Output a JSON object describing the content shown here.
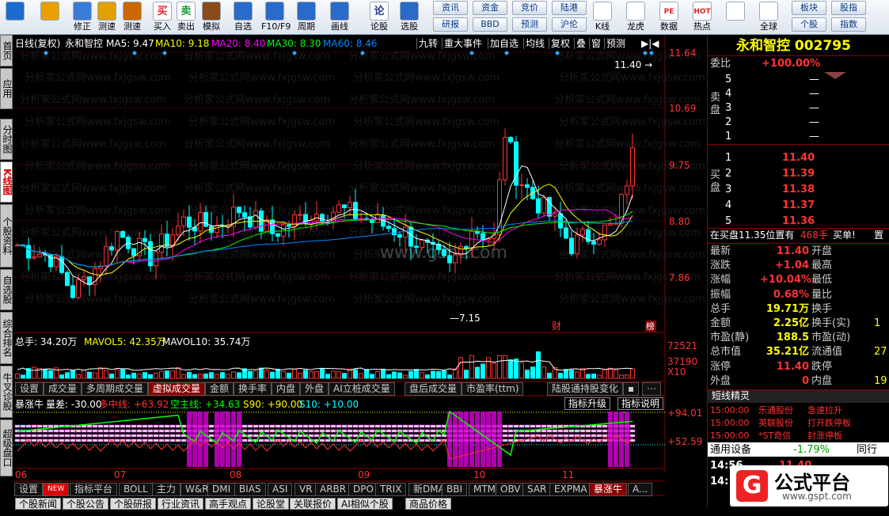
{
  "toolbar": {
    "buttons": [
      {
        "label": "",
        "icon": "home-icon"
      },
      {
        "label": "",
        "icon": "back-arrow-icon"
      },
      {
        "label": "修正",
        "icon": "arrow-up-down-icon"
      },
      {
        "label": "测速",
        "icon": "speed-icon"
      },
      {
        "label": "测速",
        "icon": "clock-icon"
      },
      {
        "label": "买入",
        "icon": "buy-icon",
        "glyph": "买"
      },
      {
        "label": "卖出",
        "icon": "sell-icon",
        "glyph": "卖"
      },
      {
        "label": "模拟",
        "icon": "hammer-icon"
      },
      {
        "label": "自选",
        "icon": "portfolio-icon"
      },
      {
        "label": "F10/F9",
        "icon": "f10-icon"
      },
      {
        "label": "周期",
        "icon": "period-icon"
      },
      {
        "label": "画线",
        "icon": "draw-line-icon"
      },
      {
        "label": "论股",
        "icon": "discuss-icon",
        "glyph": "论"
      },
      {
        "label": "选股",
        "icon": "select-stock-icon"
      }
    ],
    "small_buttons": [
      "资讯",
      "资金",
      "竞价",
      "陆港",
      "研报",
      "BBD",
      "预测",
      "沪伦"
    ],
    "right_buttons": [
      {
        "label": "K线",
        "icon": "kline-chart-icon"
      },
      {
        "label": "龙虎",
        "icon": "dragon-tiger-icon"
      },
      {
        "label": "数据",
        "icon": "pe-data-icon",
        "glyph": "PE"
      },
      {
        "label": "热点",
        "icon": "hot-icon",
        "glyph": "HOT"
      },
      {
        "label": "",
        "icon": "phone-icon"
      },
      {
        "label": "全球",
        "icon": "globe-icon"
      }
    ],
    "right_small": [
      "板块",
      "股指",
      "个股",
      "指数"
    ]
  },
  "left_tabs": [
    "首页",
    "应用",
    "分时图",
    "K线图",
    "个股资料",
    "自选股",
    "综合排名",
    "牛叉诊股",
    "超级盘口"
  ],
  "chart_header": {
    "mode": "日线(复权)",
    "stock": "永和智控",
    "ma5": "MA5: 9.47",
    "ma10": "MA10: 9.18",
    "ma20": "MA20: 8.40",
    "ma30": "MA30: 8.30",
    "ma60": "MA60: 8.46",
    "tabs": [
      "九转",
      "重大事件",
      "加自选",
      "均线",
      "复权",
      "叠",
      "窗",
      "预测"
    ]
  },
  "watermark_text": "分析家公式网www.fxjgsw.com",
  "watermark_center": "www.gspt.com",
  "price_axis": [
    "11.64",
    "10.69",
    "9.75",
    "8.80",
    "7.86"
  ],
  "high_label": "11.40",
  "low_label": "7.15",
  "marker_cai": "财",
  "marker_bang": "榜",
  "volume_header": {
    "total": "总手: 34.20万",
    "mavol5": "MAVOL5: 42.35万",
    "mavol10": "MAVOL10: 35.74万"
  },
  "volume_axis": [
    "72521",
    "37190",
    "X10"
  ],
  "panel_tabs": [
    "设置",
    "成交量",
    "多周期成交量",
    "虚拟成交量",
    "金额",
    "换手率",
    "内盘",
    "外盘",
    "AI立桩成交量",
    "盘后成交量",
    "市盈率(ttm)",
    "陆股通持股变化",
    "▪",
    "⋯"
  ],
  "indicator_header": {
    "name": "暴涨牛",
    "spread": "量差: -30.00",
    "long": "多中线: +63.92",
    "short": "空主线: +34.63",
    "s90": "S90: +90.00",
    "s10": "S10: +10.00",
    "btn1": "指标升级",
    "btn2": "指标说明"
  },
  "indicator_axis": [
    "+94.01",
    "+52.59"
  ],
  "date_axis": [
    "06",
    "07",
    "08",
    "09",
    "10",
    "11"
  ],
  "bottom_tabs": [
    "设置",
    "NEW",
    "指标平台",
    "BOLL",
    "主力",
    "W&R",
    "DMI",
    "BIAS",
    "ASI",
    "VR",
    "ARBR",
    "DPO",
    "TRIX",
    "新DMA",
    "BBI",
    "MTM",
    "OBV",
    "SAR",
    "EXPMA",
    "暴涨牛",
    "A..."
  ],
  "news_tabs": [
    "个股新闻",
    "个股公告",
    "个股研报",
    "行业资讯",
    "高手观点",
    "论股堂",
    "关联报价",
    "AI相似个股",
    "商品价格"
  ],
  "quote": {
    "title": "永和智控 002795",
    "webi_label": "委比",
    "webi": "+100.00%",
    "sell_label": "卖盘",
    "sells": [
      {
        "lvl": "5",
        "p": "",
        "v": "—"
      },
      {
        "lvl": "4",
        "p": "",
        "v": "—"
      },
      {
        "lvl": "3",
        "p": "",
        "v": "—"
      },
      {
        "lvl": "2",
        "p": "",
        "v": "—"
      },
      {
        "lvl": "1",
        "p": "",
        "v": "—"
      }
    ],
    "buy_label": "买盘",
    "buys": [
      {
        "lvl": "1",
        "p": "11.40",
        "v": ""
      },
      {
        "lvl": "2",
        "p": "11.39",
        "v": ""
      },
      {
        "lvl": "3",
        "p": "11.38",
        "v": ""
      },
      {
        "lvl": "4",
        "p": "11.37",
        "v": ""
      },
      {
        "lvl": "5",
        "p": "11.36",
        "v": ""
      }
    ],
    "info_line": "在买盘11.35位置有",
    "info_qty": "468手",
    "info_act": "买单!",
    "info_extra": "置",
    "stats": [
      [
        "最新",
        "11.40",
        "开盘",
        ""
      ],
      [
        "涨跌",
        "+1.04",
        "最高",
        ""
      ],
      [
        "涨幅",
        "+10.04%",
        "最低",
        ""
      ],
      [
        "振幅",
        "0.68%",
        "量比",
        ""
      ],
      [
        "总手",
        "19.71万",
        "换手",
        ""
      ],
      [
        "金额",
        "2.25亿",
        "换手(实)",
        "1"
      ],
      [
        "市盈(静)",
        "188.5",
        "市盈(动)",
        ""
      ],
      [
        "总市值",
        "35.21亿",
        "流通值",
        "27"
      ],
      [
        "涨停",
        "11.40",
        "跌停",
        ""
      ],
      [
        "外盘",
        "0",
        "内盘",
        "19"
      ]
    ],
    "short_title": "短线精灵",
    "shorts": [
      [
        "15:00:00",
        "乐通股份",
        "急速拉升"
      ],
      [
        "15:00:00",
        "英联股份",
        "打开跌停板"
      ],
      [
        "15:00:00",
        "*ST奇信",
        "封涨停板"
      ]
    ],
    "device_label": "通用设备",
    "device_pct": "-1.79%",
    "device_extra": "同行",
    "ticks": [
      [
        "14:56",
        "11.40"
      ],
      [
        "14:",
        ""
      ]
    ],
    "logo_text": "公式平台",
    "logo_url": "www.gspt.com",
    "logo_glyph": "G"
  }
}
